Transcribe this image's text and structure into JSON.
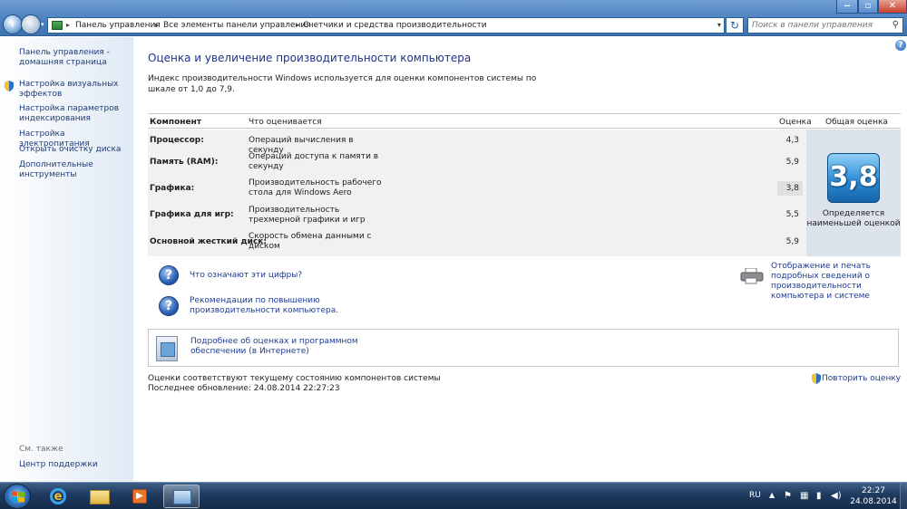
{
  "window": {
    "controls": {
      "minimize": "‒",
      "maximize": "▫",
      "close": "✕"
    }
  },
  "address_bar": {
    "breadcrumbs": [
      "Панель управления",
      "Все элементы панели управления",
      "Счетчики и средства производительности"
    ],
    "search_placeholder": "Поиск в панели управления"
  },
  "sidebar": {
    "items": [
      "Панель управления - домашняя страница",
      "Настройка визуальных эффектов",
      "Настройка параметров индексирования",
      "Настройка электропитания",
      "Открыть очистку диска",
      "Дополнительные инструменты"
    ],
    "see_also_label": "См. также",
    "support_link": "Центр поддержки"
  },
  "main": {
    "title": "Оценка и увеличение производительности компьютера",
    "intro": "Индекс производительности Windows используется для оценки компонентов системы по шкале от 1,0 до 7,9.",
    "table": {
      "headers": {
        "component": "Компонент",
        "rated": "Что оценивается",
        "score": "Оценка",
        "overall": "Общая оценка"
      },
      "rows": [
        {
          "component": "Процессор:",
          "rated": "Операций вычисления в секунду",
          "score": "4,3"
        },
        {
          "component": "Память (RAM):",
          "rated": "Операций доступа к памяти в секунду",
          "score": "5,9"
        },
        {
          "component": "Графика:",
          "rated": "Производительность рабочего стола для Windows Aero",
          "score": "3,8"
        },
        {
          "component": "Графика для игр:",
          "rated": "Производительность трехмерной графики и игр",
          "score": "5,5"
        },
        {
          "component": "Основной жесткий диск:",
          "rated": "Скорость обмена данными с диском",
          "score": "5,9"
        }
      ],
      "overall_score": "3,8",
      "overall_note": "Определяется наименьшей оценкой"
    },
    "links": {
      "what_numbers": "Что означают эти цифры?",
      "recommendations": "Рекомендации по повышению производительности компьютера.",
      "print_details": "Отображение и печать подробных сведений о производительности компьютера и системе",
      "more_info": "Подробнее об оценках и программном обеспечении (в Интернете)",
      "rerun": "Повторить оценку"
    },
    "status": {
      "current": "Оценки соответствуют текущему состоянию компонентов системы",
      "last_update": "Последнее обновление: 24.08.2014 22:27:23"
    }
  },
  "taskbar": {
    "language": "RU",
    "time": "22:27",
    "date": "24.08.2014",
    "apps": [
      "internet-explorer",
      "windows-explorer",
      "media-player",
      "control-panel"
    ]
  },
  "colors": {
    "title_bar": "#4d82bf",
    "heading": "#1e3287",
    "link": "#1e3c96",
    "sidebar_link": "#1e3c78",
    "score_badge": "#2d8ed6"
  }
}
